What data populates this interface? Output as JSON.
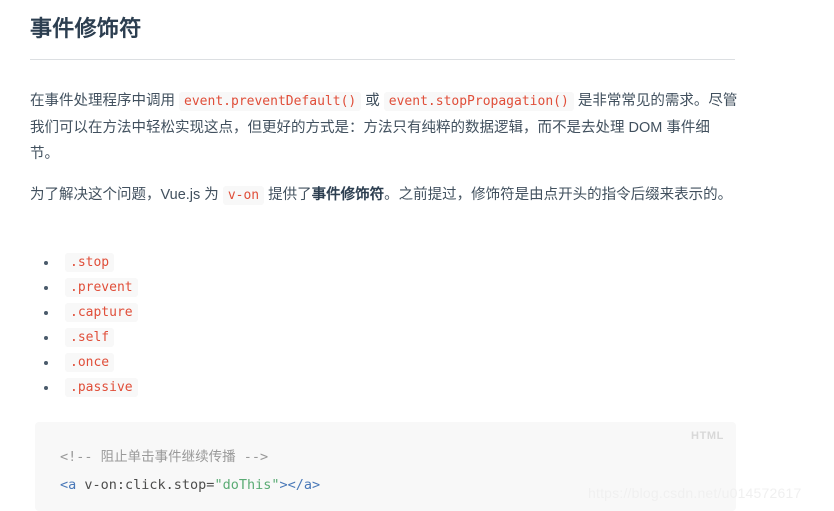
{
  "document": {
    "heading": "事件修饰符",
    "paragraphs": [
      {
        "id": "para-1",
        "segments": [
          {
            "type": "text",
            "value": "在事件处理程序中调用 "
          },
          {
            "type": "code",
            "value": "event.preventDefault()"
          },
          {
            "type": "text",
            "value": " 或 "
          },
          {
            "type": "code",
            "value": "event.stopPropagation()"
          },
          {
            "type": "text",
            "value": " 是非常常见的需求。尽管我们可以在方法中轻松实现这点，但更好的方式是：方法只有纯粹的数据逻辑，而不是去处理 DOM 事件细节。"
          }
        ]
      },
      {
        "id": "para-2",
        "segments": [
          {
            "type": "text",
            "value": "为了解决这个问题，Vue.js 为 "
          },
          {
            "type": "code",
            "value": "v-on"
          },
          {
            "type": "text",
            "value": " 提供了"
          },
          {
            "type": "bold",
            "value": "事件修饰符"
          },
          {
            "type": "text",
            "value": "。之前提过，修饰符是由点开头的指令后缀来表示的。"
          }
        ]
      }
    ],
    "modifier_list": [
      ".stop",
      ".prevent",
      ".capture",
      ".self",
      ".once",
      ".passive"
    ],
    "code_block": {
      "language_label": "HTML",
      "lines": [
        [
          {
            "type": "comment",
            "value": "<!-- 阻止单击事件继续传播 -->"
          }
        ],
        [
          {
            "type": "tag",
            "value": "<a"
          },
          {
            "type": "attr",
            "value": " v-on:click.stop="
          },
          {
            "type": "string",
            "value": "\"doThis\""
          },
          {
            "type": "tag",
            "value": ">"
          },
          {
            "type": "tag",
            "value": "</a>"
          }
        ]
      ],
      "plain_text": "<!-- 阻止单击事件继续传播 -->\n<a v-on:click.stop=\"doThis\"></a>"
    },
    "watermark": "https://blog.csdn.net/u014572617"
  },
  "colors": {
    "heading": "#2c3e50",
    "body_text": "#41505e",
    "inline_code_text": "#e04e39",
    "inline_code_bg": "#f8f8f8",
    "code_block_bg": "#f8f8f8",
    "code_comment": "#999999",
    "code_tag": "#4978b8",
    "code_string": "#5aab74",
    "lang_label": "#d8d8d8",
    "rule": "#dcdfe2",
    "watermark": "#f0f0f0"
  }
}
